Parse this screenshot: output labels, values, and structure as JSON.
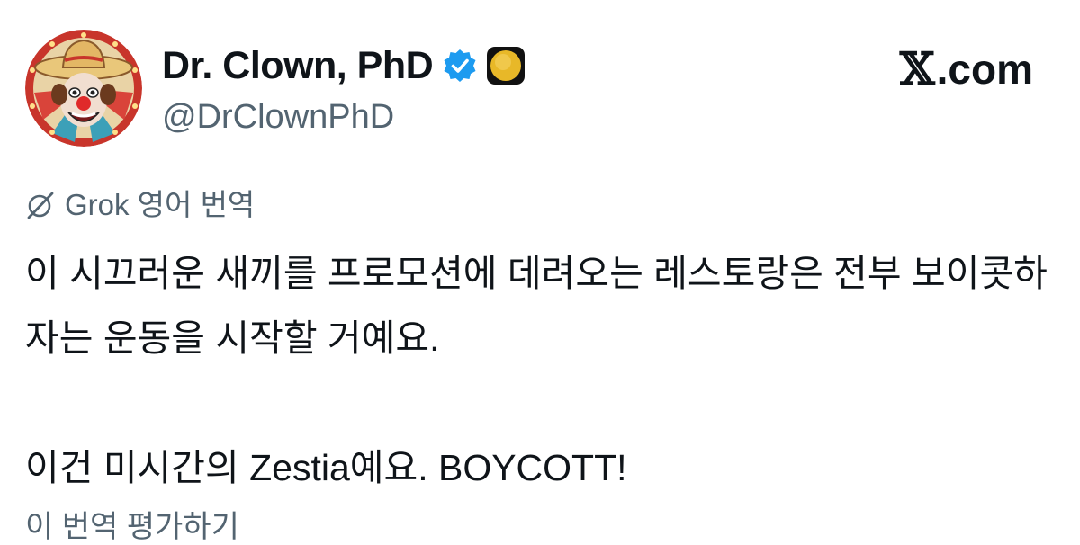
{
  "author": {
    "display_name": "Dr. Clown, PhD",
    "handle": "@DrClownPhD",
    "avatar_icon": "clown-avatar",
    "verified_icon": "verified-badge-icon",
    "verified_color": "#1d9bf0",
    "affiliate_icon": "gold-badge-icon",
    "affiliate_color": "#e8b828"
  },
  "site": {
    "logo_mark": "𝕏",
    "logo_text": ".com"
  },
  "translation": {
    "icon": "grok-icon",
    "label": "Grok 영어 번역"
  },
  "tweet": {
    "paragraph1": "이 시끄러운 새끼를 프로모션에 데려오는 레스토랑은 전부 보이콧하자는 운동을 시작할 거예요.",
    "paragraph2": "이건 미시간의 Zestia예요. BOYCOTT!"
  },
  "footer": {
    "partial_text": "이 번역 평가하기"
  }
}
